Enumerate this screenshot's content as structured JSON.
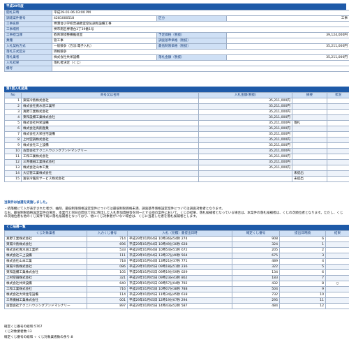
{
  "page_title": "平成29年度",
  "info": {
    "rows": [
      {
        "label": "開札日時",
        "value": "平成29-01-06 03:00 PM",
        "label2": "",
        "value2": ""
      },
      {
        "label": "調達案件番号",
        "value": "4281000518",
        "label2": "区分",
        "value2": "工事"
      },
      {
        "label": "工事名称",
        "value": "堺港台小学校普通教室空気調和設備工事",
        "label2": "",
        "value2": ""
      },
      {
        "label": "工事場所",
        "value": "堺市南区堺港台3丁39番1号",
        "label2": "",
        "value2": ""
      },
      {
        "label": "工事担当課",
        "value": "教育環境整備推進室",
        "label2": "予定価格（税抜）",
        "value2": "39,124,000円"
      },
      {
        "label": "業種",
        "value": "管工事",
        "label2": "調査基準価格（税抜）",
        "value2": ""
      },
      {
        "label": "入札契約方式",
        "value": "一般競争（方法:電子入札）",
        "label2": "最低制限価格（税抜）",
        "value2": "35,211,000円"
      },
      {
        "label": "落札方式区分",
        "value": "価格競争",
        "label2": "",
        "value2": ""
      },
      {
        "label": "落札業者",
        "value": "株式会社共栄設備",
        "label2": "落札金額（税抜）",
        "value2": "35,211,000円"
      },
      {
        "label": "入札結果",
        "value": "落札者決定（くじ）",
        "label2": "",
        "value2": ""
      },
      {
        "label": "備考",
        "value": "",
        "label2": "",
        "value2": ""
      }
    ]
  },
  "bids": {
    "title": "第1回入札結果",
    "headers": [
      "No",
      "商号又は名称",
      "入札金額(税抜)",
      "摘要",
      "状況"
    ],
    "rows": [
      {
        "no": "1",
        "name": "東陽冷熱株式会社",
        "amount": "35,211,000円",
        "note": "",
        "status": ""
      },
      {
        "no": "2",
        "name": "株式会社寛水道工業所",
        "amount": "35,211,000円",
        "note": "",
        "status": ""
      },
      {
        "no": "3",
        "name": "真野工業株式会社",
        "amount": "35,211,000円",
        "note": "",
        "status": ""
      },
      {
        "no": "4",
        "name": "東和設備工業株式会社",
        "amount": "35,211,000円",
        "note": "",
        "status": ""
      },
      {
        "no": "5",
        "name": "株式会社共栄設備",
        "amount": "35,211,000円",
        "note": "落札",
        "status": ""
      },
      {
        "no": "6",
        "name": "株式会社高翔産業",
        "amount": "35,211,000円",
        "note": "",
        "status": ""
      },
      {
        "no": "7",
        "name": "株式会社大栄住宅設備",
        "amount": "35,211,000円",
        "note": "",
        "status": ""
      },
      {
        "no": "8",
        "name": "上村空調株式会社",
        "amount": "35,211,000円",
        "note": "",
        "status": ""
      },
      {
        "no": "9",
        "name": "株式会社三上設備",
        "amount": "35,211,000円",
        "note": "",
        "status": ""
      },
      {
        "no": "10",
        "name": "古賀会社テクニハウジングアンドマシナリー",
        "amount": "35,211,000円",
        "note": "",
        "status": ""
      },
      {
        "no": "11",
        "name": "工和工業株式会社",
        "amount": "35,211,000円",
        "note": "",
        "status": ""
      },
      {
        "no": "12",
        "name": "三青機械工業株式会社",
        "amount": "35,211,000円",
        "note": "",
        "status": ""
      },
      {
        "no": "13",
        "name": "株式会社山本工業",
        "amount": "35,211,000円",
        "note": "",
        "status": ""
      },
      {
        "no": "14",
        "name": "大信管工業株式会社",
        "amount": "",
        "note": "未提出",
        "status": ""
      },
      {
        "no": "15",
        "name": "富泉冷暖房サービス株式会社",
        "amount": "",
        "note": "未提出",
        "status": ""
      }
    ]
  },
  "notice": {
    "headline": "当案件は抽選を実施しました。",
    "p1": "・続落機にて入が表示された者が、抽剤、最低制限価格設定案件については最低制限価格未満、調査基準価格設定案件については調査対象者となります。",
    "p2": "なお、最低制限価格設定案件の場合、本業代と同日の間化て同に際出した入札参加資格等を同一とする他の案件において、くじの結果、落札候補者となっている場合は、本案件の落札候補者は、くじの次順位者となります。ただし、くじの次順位者も他のくじ案件で既に落札候補者となっており、他にくじ対象者がいない場合は、くじに当選した者を落札候補者とします。"
  },
  "lottery": {
    "title": "くじ抽選一覧",
    "headers": [
      "くじ対象業者",
      "入力くじ番号",
      "入札（見積）書提出日時",
      "確定くじ番号",
      "提出日時順",
      "結果"
    ],
    "rows": [
      {
        "name": "真野工業株式会社",
        "num": "714",
        "date": "平成29年01月04日 10時36分54秒 274",
        "fixed": "908",
        "order": "6",
        "result": ""
      },
      {
        "name": "東陽冷熱株式会社",
        "num": "696",
        "date": "平成29年01月04日 10時49分30秒 628",
        "fixed": "324",
        "order": "1",
        "result": ""
      },
      {
        "name": "株式会社寛水道工業所",
        "num": "533",
        "date": "平成29年01月04日 10時54分51秒 672",
        "fixed": "205",
        "order": "2",
        "result": ""
      },
      {
        "name": "株式会社三上設備",
        "num": "111",
        "date": "平成29年01月04日 13時37分40秒 564",
        "fixed": "675",
        "order": "3",
        "result": ""
      },
      {
        "name": "株式会社山本工業",
        "num": "718",
        "date": "平成29年01月04日 13時21分37秒 771",
        "fixed": "489",
        "order": "4",
        "result": ""
      },
      {
        "name": "東陽冷熱株式会社",
        "num": "086",
        "date": "平成29年01月05日 09時18分51秒 236",
        "fixed": "322",
        "order": "5",
        "result": ""
      },
      {
        "name": "東和設備工業株式会社",
        "num": "105",
        "date": "平成29年01月05日 09時19分59秒 029",
        "fixed": "134",
        "order": "6",
        "result": ""
      },
      {
        "name": "上村空調株式会社",
        "num": "321",
        "date": "平成29年01月05日 09時23分43秒 862",
        "fixed": "183",
        "order": "7",
        "result": ""
      },
      {
        "name": "株式会社共栄設備",
        "num": "640",
        "date": "平成29年01月05日 09時57分04秒 792",
        "fixed": "432",
        "order": "8",
        "result": "○"
      },
      {
        "name": "工和工業株式会社",
        "num": "716",
        "date": "平成29年01月05日 10時07分38秒 788",
        "fixed": "504",
        "order": "9",
        "result": ""
      },
      {
        "name": "株式会社大栄住宅設備",
        "num": "114",
        "date": "平成29年01月05日 11時34分45秒 618",
        "fixed": "732",
        "order": "10",
        "result": ""
      },
      {
        "name": "三青機械工業株式会社",
        "num": "001",
        "date": "平成29年01月05日 12時19分07秒 294",
        "fixed": "295",
        "order": "11",
        "result": ""
      },
      {
        "name": "古賀会社テクニハウジングアンドマシナリー",
        "num": "897",
        "date": "平成29年01月05日 14時43分52秒 587",
        "fixed": "484",
        "order": "12",
        "result": ""
      }
    ]
  },
  "summary": {
    "line1": "確定くじ番号の総和:5767",
    "line2": "くじ対象業者数:13",
    "line3": "確定くじ番号の総和 ÷ くじ対象業者数の余り:8"
  }
}
